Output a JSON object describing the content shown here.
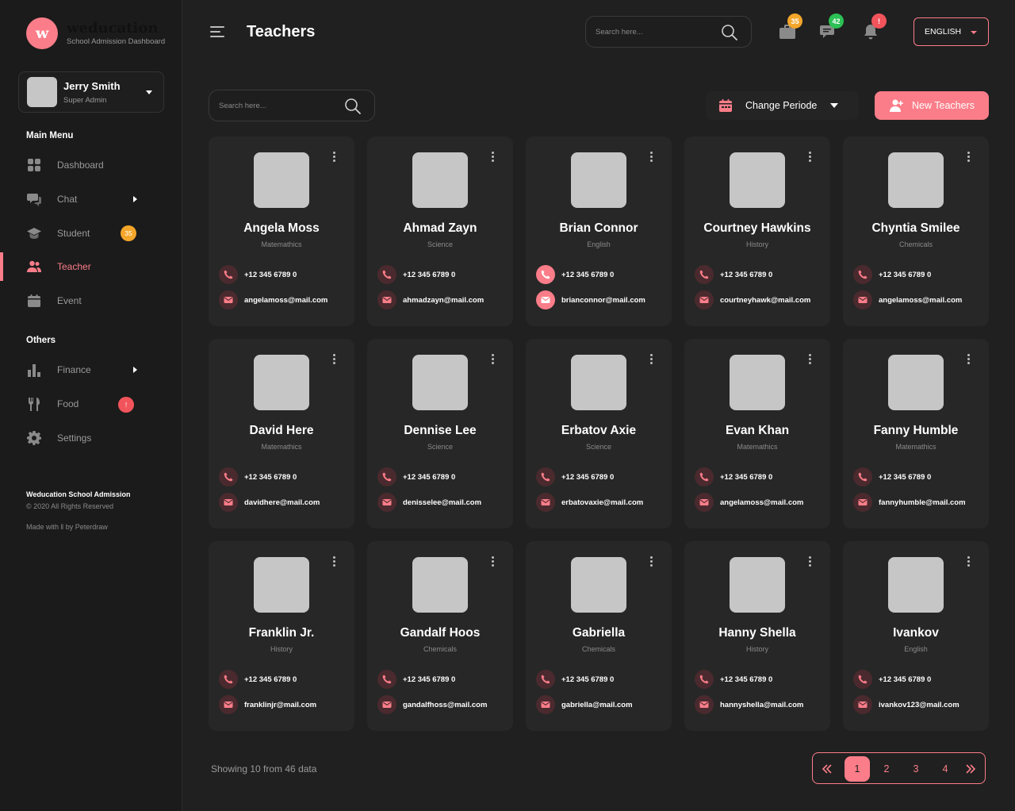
{
  "brand": {
    "logo_letter": "w",
    "name": "weducation",
    "subtitle": "School Admission Dashboard"
  },
  "user": {
    "name": "Jerry Smith",
    "role": "Super Admin"
  },
  "sidebar": {
    "main_heading": "Main Menu",
    "main_items": [
      {
        "label": "Dashboard",
        "icon": "dashboard-icon"
      },
      {
        "label": "Chat",
        "icon": "chat-icon"
      },
      {
        "label": "Student",
        "icon": "graduation-cap-icon",
        "badge": "35"
      },
      {
        "label": "Teacher",
        "icon": "users-icon",
        "active": true
      },
      {
        "label": "Event",
        "icon": "calendar-icon"
      }
    ],
    "others_heading": "Others",
    "other_items": [
      {
        "label": "Finance",
        "icon": "bar-chart-icon"
      },
      {
        "label": "Food",
        "icon": "fork-knife-icon",
        "badge": "!"
      },
      {
        "label": "Settings",
        "icon": "gear-icon"
      }
    ],
    "footer": {
      "title": "Weducation School Admission",
      "copyright": "© 2020 All Rights Reserved",
      "made_by": "Made with ‖ by Peterdraw"
    }
  },
  "header": {
    "title": "Teachers",
    "search_placeholder": "Search here...",
    "badges": {
      "briefcase": "35",
      "messages": "42",
      "notifications": "!"
    },
    "language": "ENGLISH"
  },
  "toolbar": {
    "search_placeholder": "Search here...",
    "period_label": "Change Periode",
    "new_label": "New Teachers"
  },
  "teachers": [
    {
      "name": "Angela Moss",
      "subject": "Matemathics",
      "phone": "+12 345 6789 0",
      "email": "angelamoss@mail.com"
    },
    {
      "name": "Ahmad Zayn",
      "subject": "Science",
      "phone": "+12 345 6789 0",
      "email": "ahmadzayn@mail.com"
    },
    {
      "name": "Brian Connor",
      "subject": "English",
      "phone": "+12 345 6789 0",
      "email": "brianconnor@mail.com"
    },
    {
      "name": "Courtney Hawkins",
      "subject": "History",
      "phone": "+12 345 6789 0",
      "email": "courtneyhawk@mail.com"
    },
    {
      "name": "Chyntia Smilee",
      "subject": "Chemicals",
      "phone": "+12 345 6789 0",
      "email": "angelamoss@mail.com"
    },
    {
      "name": "David Here",
      "subject": "Matemathics",
      "phone": "+12 345 6789 0",
      "email": "davidhere@mail.com"
    },
    {
      "name": "Dennise Lee",
      "subject": "Science",
      "phone": "+12 345 6789 0",
      "email": "denisselee@mail.com"
    },
    {
      "name": "Erbatov Axie",
      "subject": "Science",
      "phone": "+12 345 6789 0",
      "email": "erbatovaxie@mail.com"
    },
    {
      "name": "Evan Khan",
      "subject": "Matemathics",
      "phone": "+12 345 6789 0",
      "email": "angelamoss@mail.com"
    },
    {
      "name": "Fanny Humble",
      "subject": "Matemathics",
      "phone": "+12 345 6789 0",
      "email": "fannyhumble@mail.com"
    },
    {
      "name": "Franklin Jr.",
      "subject": "History",
      "phone": "+12 345 6789 0",
      "email": "franklinjr@mail.com"
    },
    {
      "name": "Gandalf Hoos",
      "subject": "Chemicals",
      "phone": "+12 345 6789 0",
      "email": "gandalfhoss@mail.com"
    },
    {
      "name": "Gabriella",
      "subject": "Chemicals",
      "phone": "+12 345 6789 0",
      "email": "gabriella@mail.com"
    },
    {
      "name": "Hanny Shella",
      "subject": "History",
      "phone": "+12 345 6789 0",
      "email": "hannyshella@mail.com"
    },
    {
      "name": "Ivankov",
      "subject": "English",
      "phone": "+12 345 6789 0",
      "email": "ivankov123@mail.com"
    }
  ],
  "footer": {
    "showing": "Showing 10 from 46 data",
    "pages": [
      "1",
      "2",
      "3",
      "4"
    ],
    "current_page": "1"
  },
  "colors": {
    "accent": "#fb7d89",
    "background": "#202020",
    "sidebar": "#1b1b1b",
    "card": "#272727",
    "badge_orange": "#f4a62a",
    "badge_green": "#2bc155",
    "badge_red": "#f2545b"
  }
}
